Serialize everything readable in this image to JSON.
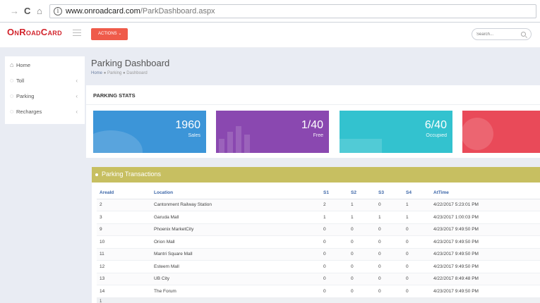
{
  "browser": {
    "url_host": "www.onroadcard.com",
    "url_path": "/ParkDashboard.aspx"
  },
  "app": {
    "logo": "OnRoadCard",
    "actions_label": "ACTIONS",
    "search_placeholder": "Search..."
  },
  "sidebar": {
    "items": [
      {
        "label": "Home",
        "icon": "home-icon"
      },
      {
        "label": "Toll",
        "icon": "pin-icon"
      },
      {
        "label": "Parking",
        "icon": "pin-icon"
      },
      {
        "label": "Recharges",
        "icon": "pin-icon"
      }
    ]
  },
  "page": {
    "title": "Parking Dashboard",
    "breadcrumb": [
      "Home",
      "Parking",
      "Dashboard"
    ]
  },
  "stats": {
    "title": "PARKING STATS",
    "tiles": [
      {
        "value": "1960",
        "label": "Sales",
        "color": "#3c95d8"
      },
      {
        "value": "1/40",
        "label": "Free",
        "color": "#8a48b0"
      },
      {
        "value": "6/40",
        "label": "Occupied",
        "color": "#33c2cf"
      },
      {
        "value": "",
        "label": "",
        "color": "#e94a59"
      }
    ]
  },
  "transactions": {
    "title": "Parking Transactions",
    "columns": [
      "AreaId",
      "Location",
      "S1",
      "S2",
      "S3",
      "S4",
      "AtTime"
    ],
    "rows": [
      [
        "2",
        "Cantonment Railway Station",
        "2",
        "1",
        "0",
        "1",
        "4/22/2017 5:23:01 PM"
      ],
      [
        "3",
        "Garuda Mall",
        "1",
        "1",
        "1",
        "1",
        "4/23/2017 1:00:03 PM"
      ],
      [
        "9",
        "Phoenix MarketCity",
        "0",
        "0",
        "0",
        "0",
        "4/23/2017 9:49:50 PM"
      ],
      [
        "10",
        "Orion Mall",
        "0",
        "0",
        "0",
        "0",
        "4/23/2017 9:49:50 PM"
      ],
      [
        "11",
        "Mantri Square Mall",
        "0",
        "0",
        "0",
        "0",
        "4/23/2017 9:49:50 PM"
      ],
      [
        "12",
        "Esteem Mall",
        "0",
        "0",
        "0",
        "0",
        "4/23/2017 9:49:50 PM"
      ],
      [
        "13",
        "UB City",
        "0",
        "0",
        "0",
        "0",
        "4/22/2017 8:49:48 PM"
      ],
      [
        "14",
        "The Forum",
        "0",
        "0",
        "0",
        "0",
        "4/23/2017 9:49:50 PM"
      ]
    ],
    "next_row_id": "1"
  }
}
